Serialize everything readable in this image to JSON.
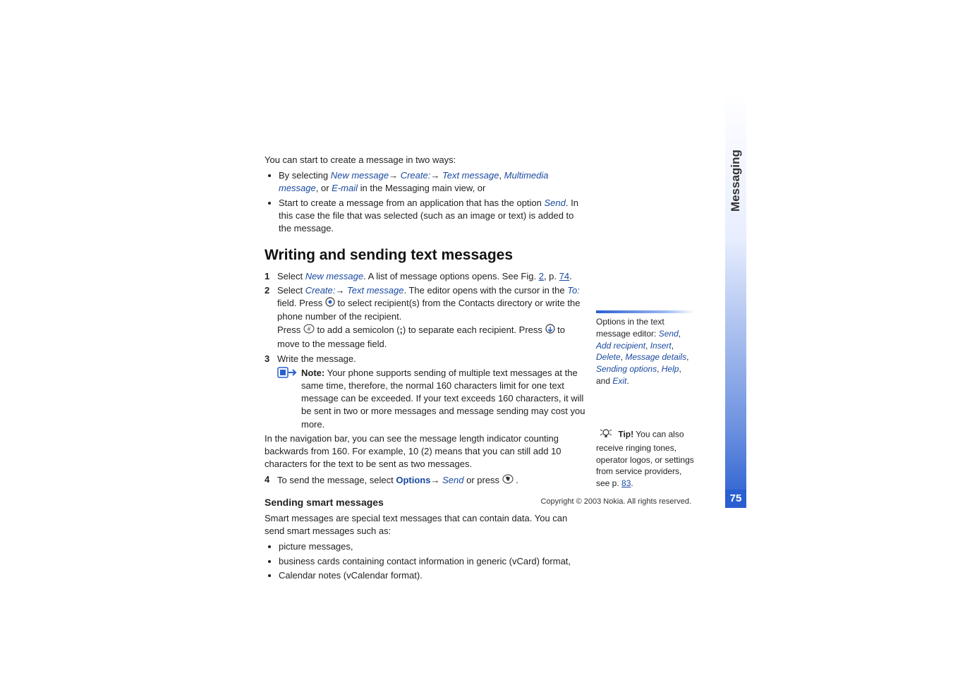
{
  "chapter_tab": "Messaging",
  "page_number": "75",
  "copyright": "Copyright © 2003 Nokia. All rights reserved.",
  "intro": "You can start to create a message in two ways:",
  "bullets_intro": {
    "b1_a": "By selecting ",
    "b1_new_message": "New message",
    "b1_arrow1": "→ ",
    "b1_create": "Create:",
    "b1_arrow2": "→ ",
    "b1_text_message": "Text message",
    "b1_sep1": ", ",
    "b1_mms": "Multimedia message",
    "b1_or": ", or ",
    "b1_email": "E-mail",
    "b1_tail": " in the Messaging main view, or",
    "b2_a": "Start to create a message from an application that has the option ",
    "b2_send": "Send",
    "b2_tail": ". In this case the file that was selected (such as an image or text) is added to the message."
  },
  "heading": "Writing and sending text messages",
  "steps": {
    "s1_a": "Select ",
    "s1_new_message": "New message",
    "s1_b": ". A list of message options opens. See Fig. ",
    "s1_fig": "2",
    "s1_c": ", p. ",
    "s1_page": "74",
    "s1_d": ".",
    "s2_a": "Select ",
    "s2_create": "Create:",
    "s2_arrow": "→ ",
    "s2_text_message": "Text message",
    "s2_b": ". The editor opens with the cursor in the ",
    "s2_to": "To:",
    "s2_c": " field. Press ",
    "s2_d": " to select recipient(s) from the Contacts directory or write the phone number of the recipient.",
    "s2_e": "Press ",
    "s2_f": " to add a semicolon (",
    "s2_semi": ";",
    "s2_g": ") to separate each recipient. Press ",
    "s2_h": " to move to the message field.",
    "s3": "Write the message.",
    "note_label": "Note:",
    "note_body": " Your phone supports sending of multiple text messages at the same time, therefore, the normal 160 characters limit for one text message can be exceeded. If your text exceeds 160 characters, it will be sent in two or more messages and message sending may cost you more.",
    "nav_info": "In the navigation bar, you can see the message length indicator counting backwards from 160. For example, 10 (2) means that you can still add 10 characters for the text to be sent as two messages.",
    "s4_a": "To send the message, select ",
    "s4_options": "Options",
    "s4_arrow": "→ ",
    "s4_send": "Send",
    "s4_b": " or press ",
    "s4_c": " ."
  },
  "sub_heading": "Sending smart messages",
  "smart_intro": "Smart messages are special text messages that can contain data. You can send smart messages such as:",
  "smart_bullets": {
    "b1": "picture messages,",
    "b2": "business cards containing contact information in generic (vCard) format,",
    "b3": "Calendar notes (vCalendar format)."
  },
  "side_options": {
    "intro": "Options in the text message editor: ",
    "o1": "Send",
    "o2": "Add recipient",
    "o3": "Insert",
    "o4": "Delete",
    "o5": "Message details",
    "o6": "Sending options",
    "o7": "Help",
    "and": ", and ",
    "o8": "Exit",
    "dot": "."
  },
  "side_tip": {
    "label": "Tip!",
    "body_a": " You can also receive ringing tones, operator logos, or settings from service providers, see p. ",
    "page": "83",
    "body_b": "."
  }
}
